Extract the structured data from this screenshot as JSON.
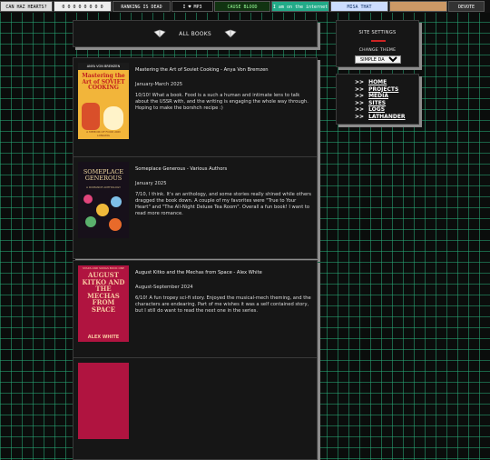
{
  "buttons": [
    {
      "label": "CAN HAZ HEARTS?",
      "bg": "#ddd",
      "fg": "#000"
    },
    {
      "label": "0 0 0 0 0 0 0 0",
      "bg": "#eee",
      "fg": "#000"
    },
    {
      "label": "RANKING IS DEAD",
      "bg": "#222",
      "fg": "#fff"
    },
    {
      "label": "I ♥ MP3",
      "bg": "#111",
      "fg": "#fff"
    },
    {
      "label": "CAUSE BLOOD",
      "bg": "#131",
      "fg": "#9f9"
    },
    {
      "label": "I am on the internet",
      "bg": "#2a8",
      "fg": "#fff"
    },
    {
      "label": "MISA THAT",
      "bg": "#cdf",
      "fg": "#136"
    },
    {
      "label": "",
      "bg": "#c96",
      "fg": "#000"
    },
    {
      "label": "DEVOTE",
      "bg": "#333",
      "fg": "#fff"
    }
  ],
  "header": {
    "title": "ALL BOOKS"
  },
  "books": [
    {
      "title": "Mastering the Art of Soviet Cooking - Anya Von Bremzen",
      "date": "January-March 2025",
      "review": "10/10! What a book. Food is a such a human and intimate lens to talk about the USSR with, and the writing is engaging the whole way through. Hoping to make the borshch recipe :)",
      "cover": {
        "top": "ANYA VON BREMZEN",
        "main": "Mastering the Art of SOVIET COOKING",
        "sub": "A MEMOIR OF FOOD AND LONGING",
        "bg": "#f2b53a",
        "fg": "#c21e1e"
      }
    },
    {
      "title": "Someplace Generous - Various Authors",
      "date": "January 2025",
      "review": "7/10, I think. It's an anthology, and some stories really shined while others dragged the book down. A couple of my favorites were \"True to Your Heart\" and \"The All-Night Deluxe Tea Room\". Overall a fun book! I want to read more romance.",
      "cover": {
        "top": "",
        "main": "SOMEPLACE GENEROUS",
        "sub": "A ROMANCE ANTHOLOGY",
        "bg": "#17101a",
        "fg": "#f1d9a0"
      }
    },
    {
      "title": "August Kitko and the Mechas from Space - Alex White",
      "date": "August-September 2024",
      "review": "6/10! A fun tropey sci-fi story. Enjoyed the musical-mech theming, and the characters are endearing. Part of me wishes it was a self contained story, but I still do want to read the next one in the series.",
      "cover": {
        "top": "STARS AND SONGS BOOK ONE",
        "main": "AUGUST KITKO AND THE MECHAS FROM SPACE",
        "sub": "ALEX WHITE",
        "bg": "#b01440",
        "fg": "#f7c6a0"
      }
    },
    {
      "title": "",
      "date": "",
      "review": "",
      "cover": {
        "top": "",
        "main": "",
        "sub": "",
        "bg": "#b01440",
        "fg": "#f7c6a0"
      }
    }
  ],
  "sidebar": {
    "settings_title": "SITE SETTINGS",
    "change_theme_label": "CHANGE THEME",
    "theme_selected": "SIMPLE DARK",
    "nav": [
      {
        "arrow": ">>",
        "label": "HOME"
      },
      {
        "arrow": ">>",
        "label": "PROJECTS"
      },
      {
        "arrow": ">>",
        "label": "MEDIA"
      },
      {
        "arrow": ">>",
        "label": "SITES"
      },
      {
        "arrow": ">>",
        "label": "LOGS"
      },
      {
        "arrow": ">>",
        "label": "LATHANDER"
      }
    ]
  }
}
